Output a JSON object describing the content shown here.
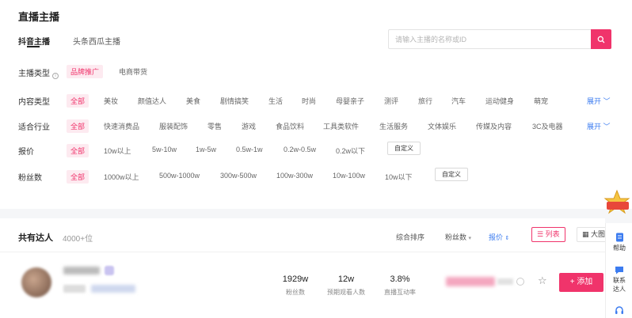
{
  "page": {
    "title": "直播主播"
  },
  "tabs": [
    {
      "label": "抖音主播",
      "active": true
    },
    {
      "label": "头条西瓜主播",
      "active": false
    }
  ],
  "search": {
    "placeholder": "请输入主播的名称或ID",
    "value": ""
  },
  "filters": {
    "anchor_type": {
      "label": "主播类型",
      "options": [
        "品牌推广",
        "电商带货"
      ],
      "selected": "品牌推广"
    },
    "content_type": {
      "label": "内容类型",
      "options": [
        "全部",
        "美妆",
        "颜值达人",
        "美食",
        "剧情搞笑",
        "生活",
        "时尚",
        "母婴亲子",
        "测评",
        "旅行",
        "汽车",
        "运动健身",
        "萌宠"
      ],
      "selected": "全部",
      "expand": "展开"
    },
    "industry": {
      "label": "适合行业",
      "options": [
        "全部",
        "快速消费品",
        "服装配饰",
        "零售",
        "游戏",
        "食品饮料",
        "工具类软件",
        "生活服务",
        "文体娱乐",
        "传媒及内容",
        "3C及电器"
      ],
      "selected": "全部",
      "expand": "展开"
    },
    "price": {
      "label": "报价",
      "options": [
        "全部",
        "10w以上",
        "5w-10w",
        "1w-5w",
        "0.5w-1w",
        "0.2w-0.5w",
        "0.2w以下"
      ],
      "selected": "全部",
      "custom": "自定义"
    },
    "fans": {
      "label": "粉丝数",
      "options": [
        "全部",
        "1000w以上",
        "500w-1000w",
        "300w-500w",
        "100w-300w",
        "10w-100w",
        "10w以下"
      ],
      "selected": "全部",
      "custom": "自定义"
    }
  },
  "results": {
    "label": "共有达人",
    "count": "4000+位",
    "sort": [
      "综合排序",
      "粉丝数",
      "报价"
    ],
    "view_list": "列表",
    "view_big": "大图"
  },
  "card": {
    "stats": [
      {
        "value": "1929w",
        "label": "粉丝数"
      },
      {
        "value": "12w",
        "label": "预期观看人数"
      },
      {
        "value": "3.8%",
        "label": "直播互动率"
      }
    ],
    "add_label": "添加"
  },
  "side": {
    "help": "帮助",
    "contact": "联系达人"
  },
  "colors": {
    "accent": "#f0346b",
    "link": "#3c7cf0"
  }
}
